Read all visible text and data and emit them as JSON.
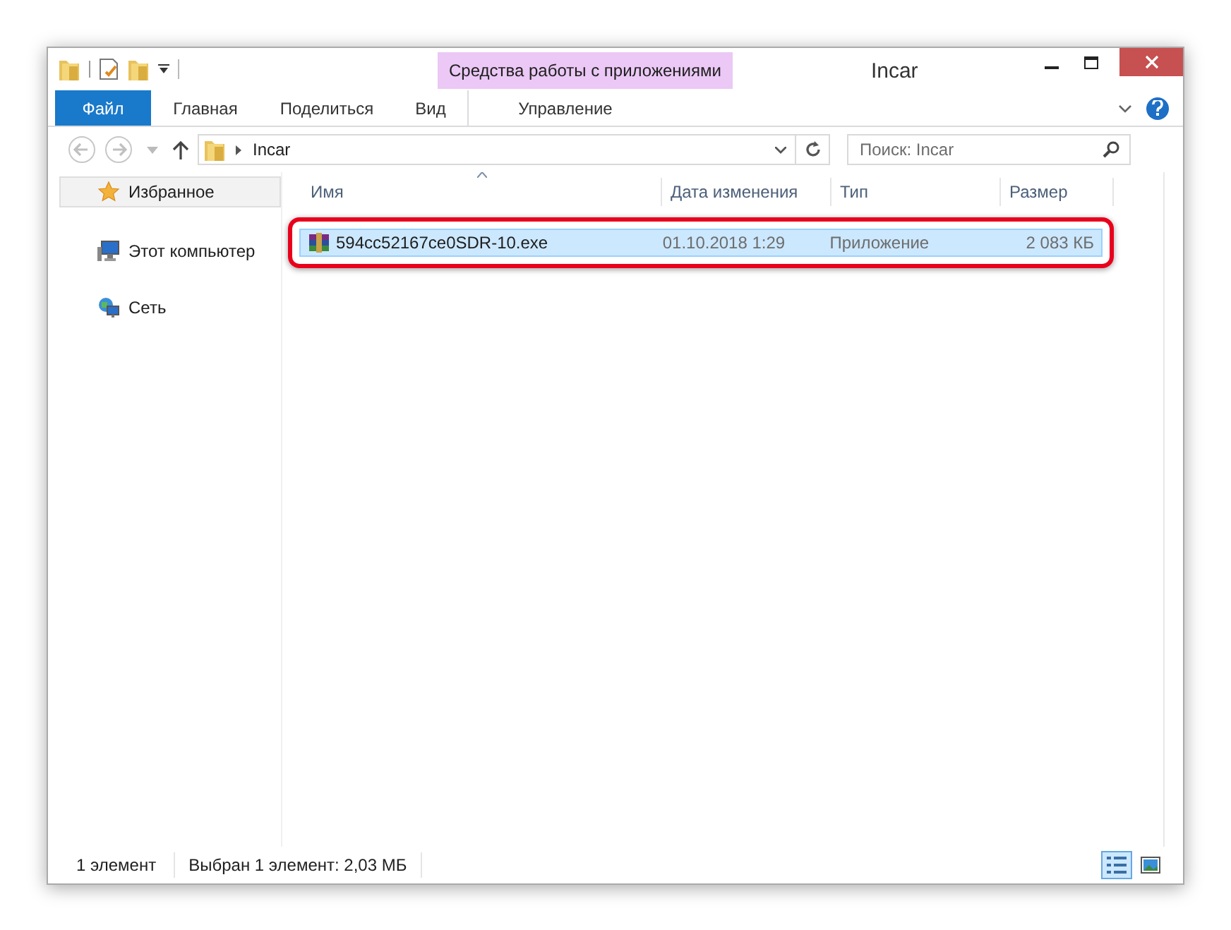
{
  "window": {
    "title": "Incar"
  },
  "context_tab_group": {
    "label": "Средства работы с приложениями"
  },
  "ribbon_tabs": [
    {
      "label": "Файл",
      "kind": "file",
      "selected": false
    },
    {
      "label": "Главная",
      "kind": "tab",
      "selected": false
    },
    {
      "label": "Поделиться",
      "kind": "tab",
      "selected": false
    },
    {
      "label": "Вид",
      "kind": "tab",
      "selected": false
    },
    {
      "label": "Управление",
      "kind": "context",
      "selected": false
    }
  ],
  "address_bar": {
    "path": [
      "Incar"
    ]
  },
  "search": {
    "placeholder": "Поиск: Incar"
  },
  "navigation": [
    {
      "label": "Избранное",
      "kind": "favorites",
      "selected": true
    },
    {
      "label": "Этот компьютер",
      "kind": "computer",
      "selected": false
    },
    {
      "label": "Сеть",
      "kind": "network",
      "selected": false
    }
  ],
  "table": {
    "columns": [
      "Имя",
      "Дата изменения",
      "Тип",
      "Размер"
    ],
    "rows": [
      {
        "cells": [
          "594cc52167ce0SDR-10.exe",
          "01.10.2018 1:29",
          "Приложение",
          "2 083 КБ"
        ],
        "selected": true,
        "highlighted": true
      }
    ]
  },
  "status_bar": {
    "count": "1 элемент",
    "selection": "Выбран 1 элемент: 2,03 МБ"
  },
  "views": [
    {
      "kind": "details",
      "selected": true
    },
    {
      "kind": "icons",
      "selected": false
    }
  ]
}
